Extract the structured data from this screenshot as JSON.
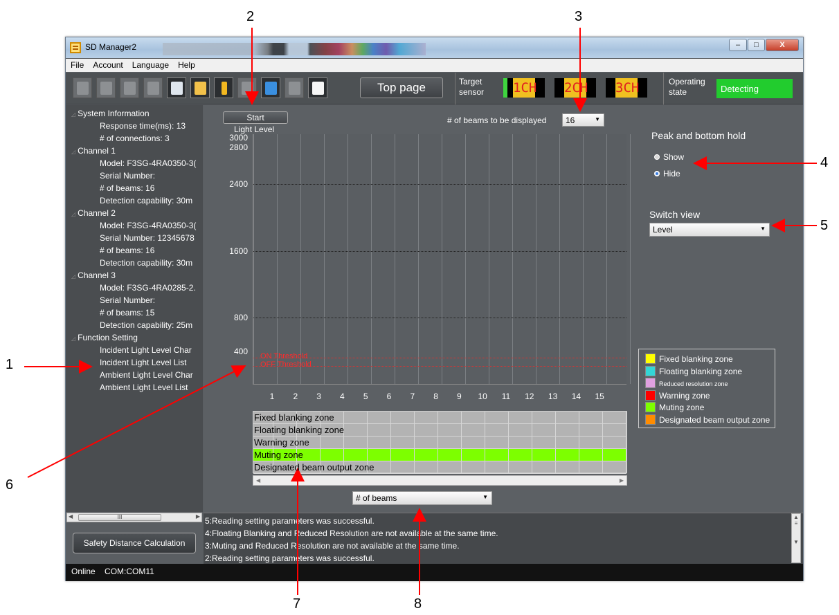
{
  "window": {
    "title": "SD Manager2",
    "min": "–",
    "max": "□",
    "close": "X"
  },
  "menu": [
    "File",
    "Account",
    "Language",
    "Help"
  ],
  "toolbar": {
    "top_page": "Top page",
    "target_label": "Target sensor",
    "channels": [
      "1CH",
      "2CH",
      "3CH"
    ],
    "operating_label": "Operating state",
    "operating_state": "Detecting",
    "operating_color": "#22cc2e"
  },
  "tree": [
    {
      "text": "System Information",
      "level": 0
    },
    {
      "text": "Response time(ms): 13",
      "level": 1
    },
    {
      "text": "# of connections: 3",
      "level": 1
    },
    {
      "text": "Channel 1",
      "level": 0
    },
    {
      "text": "Model: F3SG-4RA0350-3(",
      "level": 1
    },
    {
      "text": "Serial Number:",
      "level": 1
    },
    {
      "text": "# of beams: 16",
      "level": 1
    },
    {
      "text": "Detection capability: 30m",
      "level": 1
    },
    {
      "text": "Channel 2",
      "level": 0
    },
    {
      "text": "Model: F3SG-4RA0350-3(",
      "level": 1
    },
    {
      "text": "Serial Number: 12345678",
      "level": 1
    },
    {
      "text": "# of beams: 16",
      "level": 1
    },
    {
      "text": "Detection capability: 30m",
      "level": 1
    },
    {
      "text": "Channel 3",
      "level": 0
    },
    {
      "text": "Model: F3SG-4RA0285-2.",
      "level": 1
    },
    {
      "text": "Serial Number:",
      "level": 1
    },
    {
      "text": "# of beams: 15",
      "level": 1
    },
    {
      "text": "Detection capability: 25m",
      "level": 1
    },
    {
      "text": "Function Setting",
      "level": 0
    },
    {
      "text": "Incident Light Level Char",
      "level": 1
    },
    {
      "text": "Incident Light Level List",
      "level": 1
    },
    {
      "text": "Ambient Light Level Char",
      "level": 1
    },
    {
      "text": "Ambient Light Level List",
      "level": 1
    }
  ],
  "tree_scroll_glyph": "III",
  "safety_button": "Safety Distance Calculation",
  "main": {
    "start": "Start",
    "beams_label": "# of beams to be displayed",
    "beams_value": "16",
    "peak_title": "Peak and bottom hold",
    "peak_options": [
      "Show",
      "Hide"
    ],
    "peak_selected": "Hide",
    "switch_title": "Switch view",
    "switch_value": "Level",
    "x_axis_select": "# of beams"
  },
  "chart_data": {
    "type": "bar",
    "ylabel": "Light Level",
    "yticks": [
      400,
      800,
      1600,
      2400,
      2800,
      3000
    ],
    "ylim": [
      0,
      3000
    ],
    "categories": [
      "1",
      "2",
      "3",
      "4",
      "5",
      "6",
      "7",
      "8",
      "9",
      "10",
      "11",
      "12",
      "13",
      "14",
      "15"
    ],
    "values": [],
    "thresholds": [
      {
        "name": "ON Threshold",
        "value": 320
      },
      {
        "name": "OFF Threshold",
        "value": 220
      }
    ],
    "grid": true
  },
  "zones": [
    {
      "name": "Fixed blanking zone",
      "highlight": false
    },
    {
      "name": "Floating blanking zone",
      "highlight": false
    },
    {
      "name": "Warning zone",
      "highlight": false
    },
    {
      "name": "Muting zone",
      "highlight": true
    },
    {
      "name": "Designated beam output zone",
      "highlight": false
    }
  ],
  "legend": [
    {
      "name": "Fixed blanking zone",
      "color": "#ffff00"
    },
    {
      "name": "Floating blanking zone",
      "color": "#33d6d6"
    },
    {
      "name": "Reduced resolution zone",
      "color": "#e0a0e0"
    },
    {
      "name": "Warning zone",
      "color": "#ff0000"
    },
    {
      "name": "Muting zone",
      "color": "#7dff00"
    },
    {
      "name": "Designated beam output zone",
      "color": "#ff8c00"
    }
  ],
  "log": [
    "5:Reading setting parameters was successful.",
    "4:Floating Blanking and Reduced Resolution are not available at the same time.",
    "3:Muting and Reduced Resolution are not available at the same time.",
    "2:Reading setting parameters was successful."
  ],
  "status": {
    "online": "Online",
    "port": "COM:COM11"
  },
  "annotations": [
    "1",
    "2",
    "3",
    "4",
    "5",
    "6",
    "7",
    "8"
  ]
}
